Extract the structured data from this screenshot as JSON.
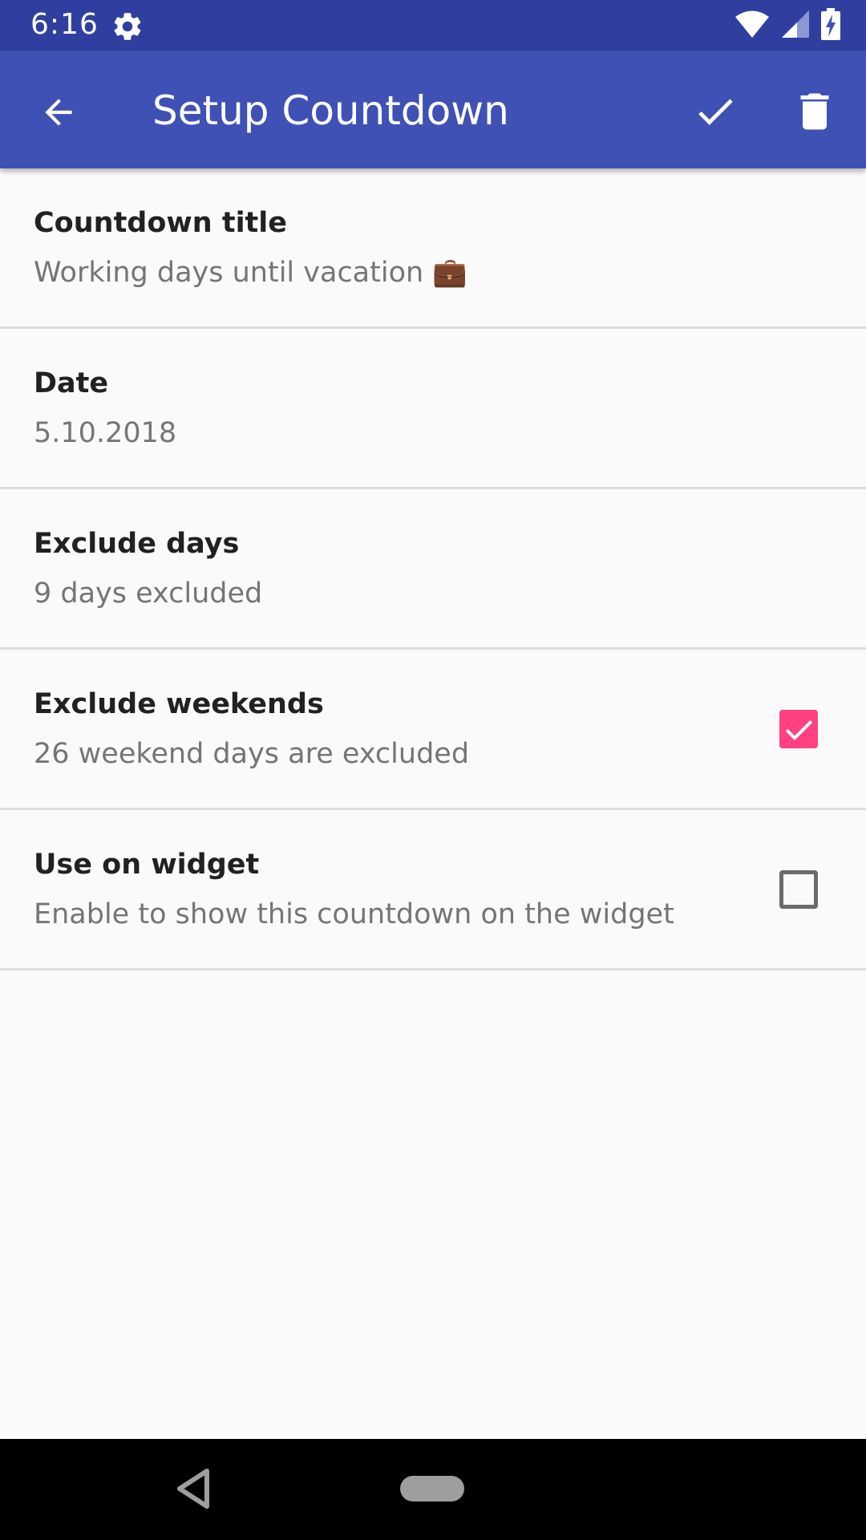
{
  "status_bar": {
    "time": "6:16",
    "icons": [
      "settings-gear-icon",
      "wifi-icon",
      "cell-signal-icon",
      "battery-charging-icon"
    ]
  },
  "app_bar": {
    "title": "Setup Countdown",
    "background": "#3f51b5",
    "actions": [
      "back-arrow-icon",
      "check-icon",
      "trash-icon"
    ]
  },
  "settings": {
    "items": [
      {
        "title": "Countdown title",
        "summary": "Working days until vacation 💼"
      },
      {
        "title": "Date",
        "summary": "5.10.2018"
      },
      {
        "title": "Exclude days",
        "summary": "9 days excluded"
      },
      {
        "title": "Exclude weekends",
        "summary": "26 weekend days are excluded",
        "checked": true
      },
      {
        "title": "Use on widget",
        "summary": "Enable to show this countdown on the widget",
        "checked": false
      }
    ]
  },
  "colors": {
    "status_bar": "#303f9f",
    "accent": "#ff4081",
    "divider": "#dedede",
    "background": "#fafafa"
  },
  "nav_bar": {
    "icons": [
      "nav-back-icon",
      "nav-home-pill"
    ]
  }
}
